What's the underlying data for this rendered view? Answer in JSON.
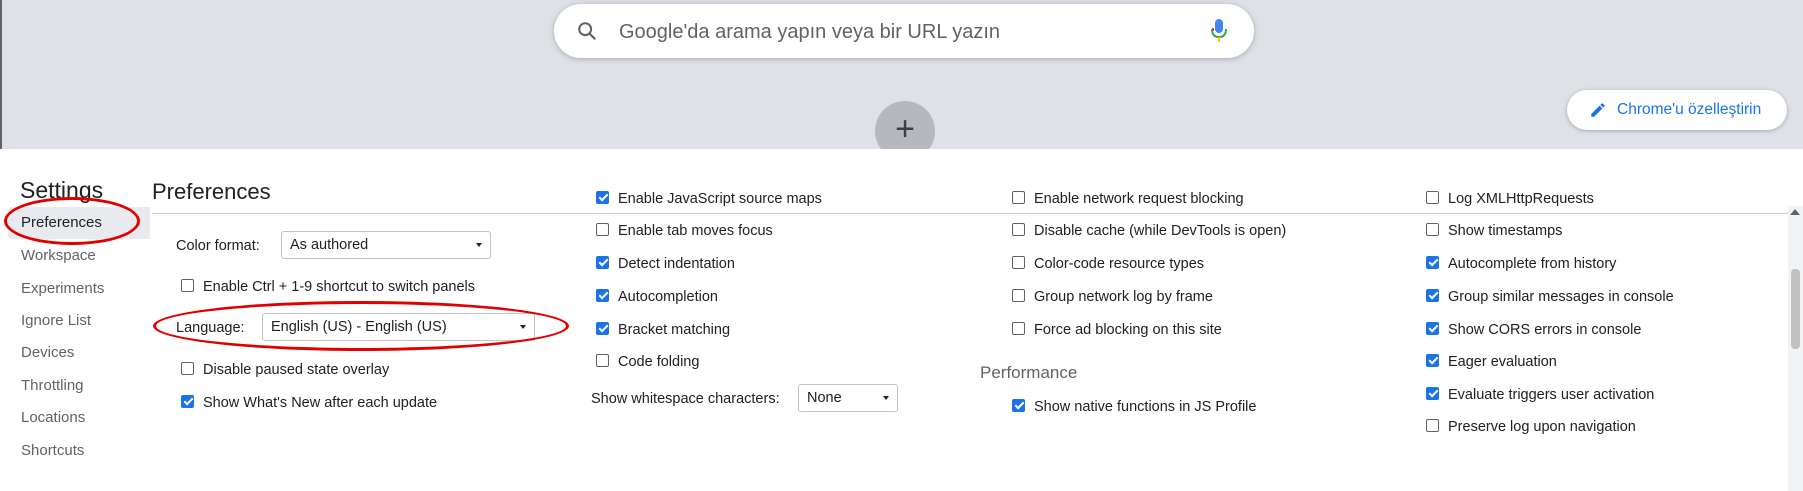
{
  "ntp": {
    "search_placeholder": "Google'da arama yapın veya bir URL yazın",
    "add_shortcut_symbol": "+",
    "customize_label": "Chrome'u özelleştirin"
  },
  "settings": {
    "title": "Settings",
    "nav": [
      "Preferences",
      "Workspace",
      "Experiments",
      "Ignore List",
      "Devices",
      "Throttling",
      "Locations",
      "Shortcuts"
    ],
    "selected_nav": "Preferences",
    "section_title": "Preferences",
    "col1": {
      "color_format_label": "Color format:",
      "color_format_value": "As authored",
      "ctrl_shortcut": {
        "label": "Enable Ctrl + 1-9 shortcut to switch panels",
        "checked": false
      },
      "language_label": "Language:",
      "language_value": "English (US) - English (US)",
      "paused_overlay": {
        "label": "Disable paused state overlay",
        "checked": false
      },
      "whats_new": {
        "label": "Show What's New after each update",
        "checked": true
      }
    },
    "col2": {
      "items": [
        {
          "label": "Enable JavaScript source maps",
          "checked": true
        },
        {
          "label": "Enable tab moves focus",
          "checked": false
        },
        {
          "label": "Detect indentation",
          "checked": true
        },
        {
          "label": "Autocompletion",
          "checked": true
        },
        {
          "label": "Bracket matching",
          "checked": true
        },
        {
          "label": "Code folding",
          "checked": false
        }
      ],
      "whitespace_label": "Show whitespace characters:",
      "whitespace_value": "None"
    },
    "col3": {
      "items": [
        {
          "label": "Enable network request blocking",
          "checked": false
        },
        {
          "label": "Disable cache (while DevTools is open)",
          "checked": false
        },
        {
          "label": "Color-code resource types",
          "checked": false
        },
        {
          "label": "Group network log by frame",
          "checked": false
        },
        {
          "label": "Force ad blocking on this site",
          "checked": false
        }
      ],
      "performance_heading": "Performance",
      "native_functions": {
        "label": "Show native functions in JS Profile",
        "checked": true
      }
    },
    "col4": {
      "items": [
        {
          "label": "Log XMLHttpRequests",
          "checked": false
        },
        {
          "label": "Show timestamps",
          "checked": false
        },
        {
          "label": "Autocomplete from history",
          "checked": true
        },
        {
          "label": "Group similar messages in console",
          "checked": true
        },
        {
          "label": "Show CORS errors in console",
          "checked": true
        },
        {
          "label": "Eager evaluation",
          "checked": true
        },
        {
          "label": "Evaluate triggers user activation",
          "checked": true
        },
        {
          "label": "Preserve log upon navigation",
          "checked": false
        }
      ]
    }
  },
  "colors": {
    "accent": "#1a73e8",
    "annotation": "#e00000",
    "ntp_bg": "#dee1e6"
  }
}
